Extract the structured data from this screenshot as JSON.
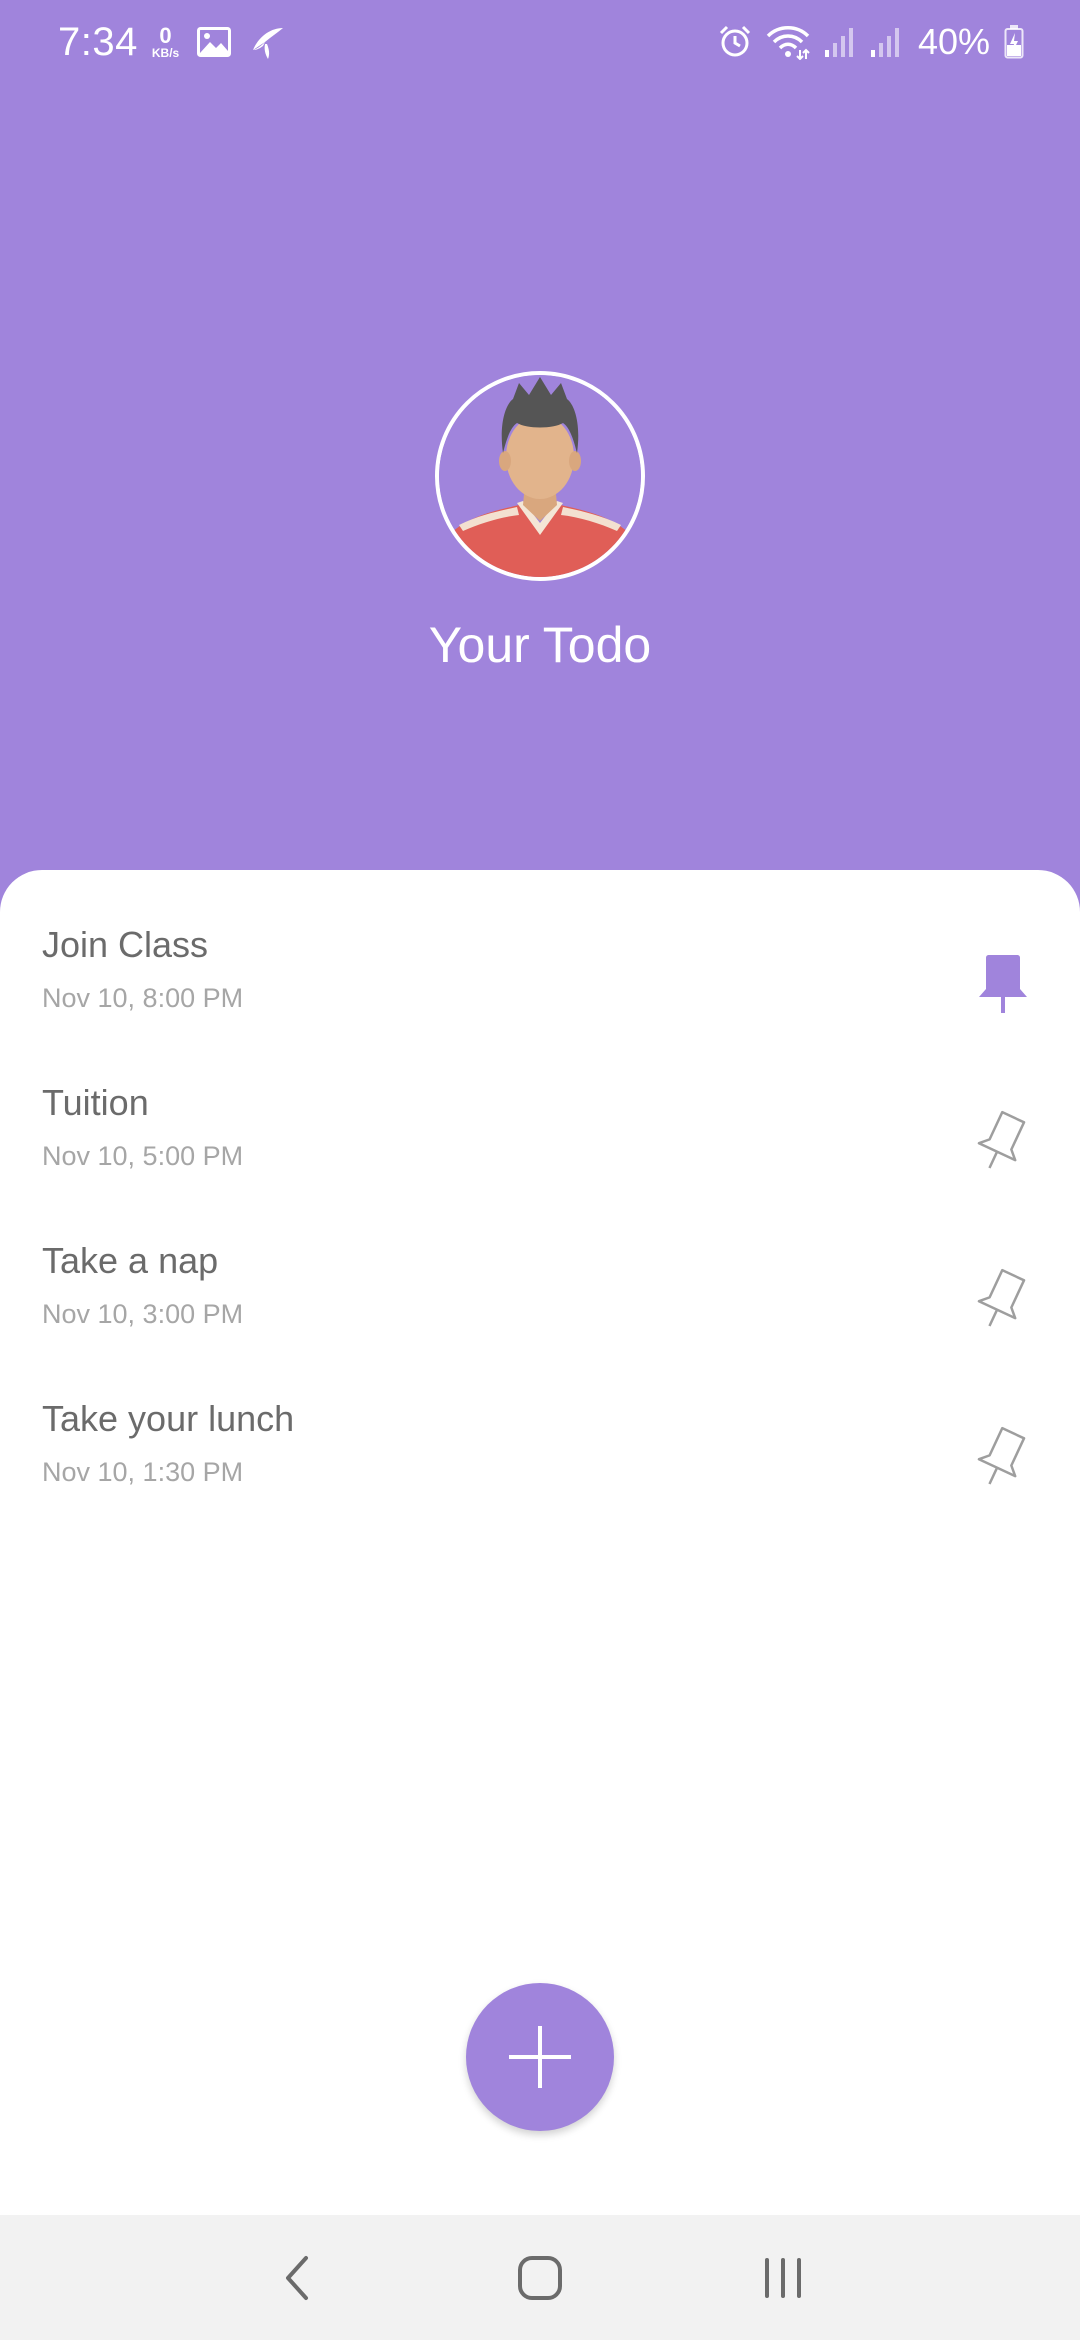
{
  "status_bar": {
    "time": "7:34",
    "net_speed_value": "0",
    "net_speed_unit": "KB/s",
    "battery": "40%",
    "icons": [
      "gallery-icon",
      "telenor-icon",
      "alarm-icon",
      "wifi-icon",
      "signal-icon",
      "signal-icon",
      "battery-charging-icon"
    ]
  },
  "header": {
    "title": "Your Todo",
    "avatar_icon": "user-avatar"
  },
  "todos": [
    {
      "title": "Join Class",
      "time": "Nov 10, 8:00 PM",
      "pinned": true
    },
    {
      "title": "Tuition",
      "time": "Nov 10, 5:00 PM",
      "pinned": false
    },
    {
      "title": "Take a nap",
      "time": "Nov 10, 3:00 PM",
      "pinned": false
    },
    {
      "title": "Take your lunch",
      "time": "Nov 10, 1:30 PM",
      "pinned": false
    }
  ],
  "fab": {
    "icon": "plus-icon"
  },
  "nav": {
    "icons": [
      "back-icon",
      "home-icon",
      "recents-icon"
    ]
  },
  "colors": {
    "accent": "#A084DC",
    "title_text": "#6b6b6b",
    "time_text": "#a6a6a6",
    "pin_inactive": "#9e9e9e"
  }
}
